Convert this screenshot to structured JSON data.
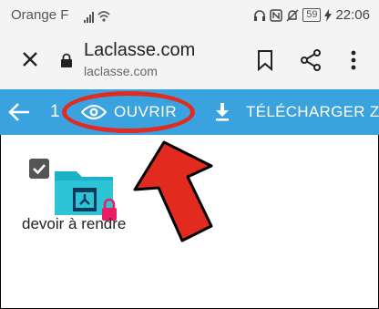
{
  "status_bar": {
    "carrier": "Orange F",
    "battery": "59",
    "time": "22:06"
  },
  "url_bar": {
    "title": "Laclasse.com",
    "domain": "laclasse.com",
    "icons": [
      "close-icon",
      "lock-icon",
      "bookmark-icon",
      "share-icon",
      "more-vert-icon"
    ]
  },
  "toolbar": {
    "selected_count": "1",
    "open_label": "OUVRIR",
    "download_label": "TÉLÉCHARGER ZIP",
    "background": "#3ba2e0"
  },
  "files": [
    {
      "name": "devoir à rendre",
      "selected": true,
      "locked": true
    }
  ],
  "annotation": {
    "color": "#e22a1f"
  }
}
